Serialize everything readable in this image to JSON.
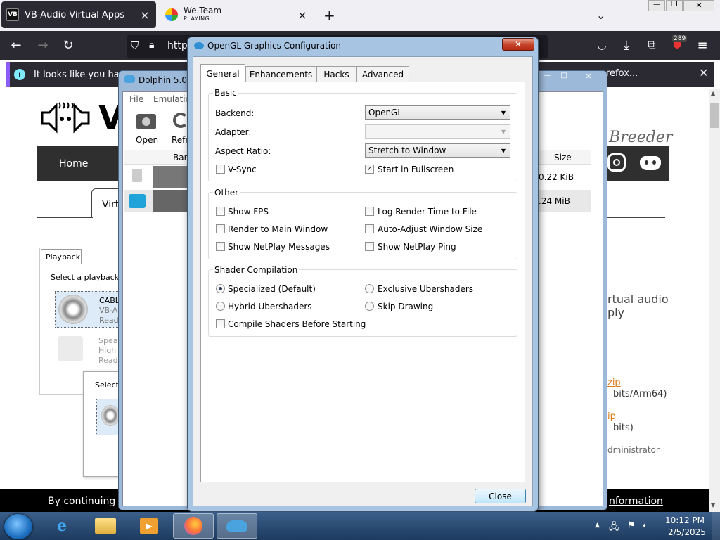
{
  "browser": {
    "tabs": [
      {
        "title": "VB-Audio Virtual Apps",
        "favicon": "VB",
        "active": true
      },
      {
        "title": "We.Team",
        "subtitle": "PLAYING",
        "active": false
      }
    ],
    "new_tab": "+",
    "list_all_tabs": "⌄",
    "url": "http",
    "notification_badge": "289",
    "infobar_text": "It looks like you haven't",
    "infobar_right_text": "refox..."
  },
  "website": {
    "nav_home": "Home",
    "tab_virtu": "Virtu",
    "breeder_text": "Breeder",
    "size_header": "Size",
    "size_1": "0.22 KiB",
    "size_2": ".24 MiB",
    "playback_tab": "Playback",
    "select_playback": "Select a playback d",
    "device1": "CABL",
    "device1_sub": "VB-A",
    "device1_status": "Read",
    "device2": "Speal",
    "device2_sub": "High",
    "device2_status": "Read",
    "select_small": "Select",
    "virtual_audio": "rtual audio",
    "virtual_audio2": "ply",
    "zip1": "zip",
    "zip1_sub": "bits/Arm64)",
    "zip2": "ip",
    "zip2_sub": "bits)",
    "administrator": "dministrator",
    "cookie_text": "By continuing br",
    "cookie_link": "nformation"
  },
  "dolphin": {
    "title": "Dolphin 5.0-",
    "menu_file": "File",
    "menu_emulation": "Emulatio",
    "toolbar_open": "Open",
    "toolbar_refresh": "Refr",
    "col_banner": "Ban"
  },
  "dialog": {
    "title": "OpenGL Graphics Configuration",
    "close_x": "✕",
    "tabs": [
      "General",
      "Enhancements",
      "Hacks",
      "Advanced"
    ],
    "basic": {
      "group_title": "Basic",
      "backend_label": "Backend:",
      "backend_value": "OpenGL",
      "adapter_label": "Adapter:",
      "adapter_value": "",
      "aspect_label": "Aspect Ratio:",
      "aspect_value": "Stretch to Window",
      "vsync_label": "V-Sync",
      "vsync_checked": false,
      "fullscreen_label": "Start in Fullscreen",
      "fullscreen_checked": true
    },
    "other": {
      "group_title": "Other",
      "show_fps": "Show FPS",
      "log_render": "Log Render Time to File",
      "render_main": "Render to Main Window",
      "auto_adjust": "Auto-Adjust Window Size",
      "show_netplay_msgs": "Show NetPlay Messages",
      "show_netplay_ping": "Show NetPlay Ping"
    },
    "shader": {
      "group_title": "Shader Compilation",
      "specialized": "Specialized (Default)",
      "exclusive": "Exclusive Ubershaders",
      "hybrid": "Hybrid Ubershaders",
      "skip": "Skip Drawing",
      "compile_before": "Compile Shaders Before Starting",
      "selected": "specialized"
    },
    "close_button": "Close"
  },
  "taskbar": {
    "time": "10:12 PM",
    "date": "2/5/2025"
  },
  "colors": {
    "firefox_dark": "#2b2a33",
    "infobar_accent": "#8b5cf6",
    "win7_title": "#a7c4e3"
  }
}
